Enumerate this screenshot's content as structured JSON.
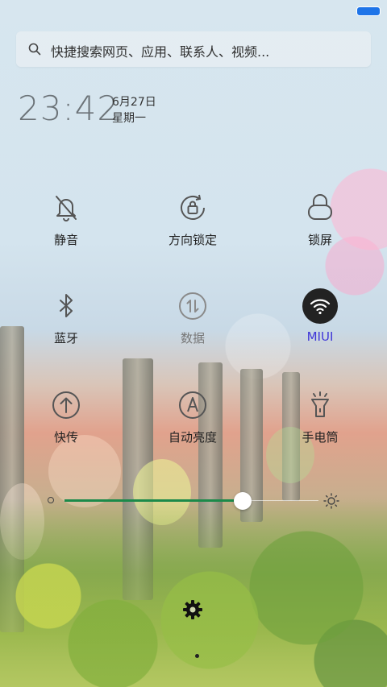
{
  "search": {
    "placeholder": "快捷搜索网页、应用、联系人、视频..."
  },
  "clock": {
    "time": "23:42",
    "date": "6月27日",
    "weekday": "星期一"
  },
  "toggles": [
    {
      "label": "静音",
      "icon": "bell-off-icon",
      "state": "off"
    },
    {
      "label": "方向锁定",
      "icon": "rotation-lock-icon",
      "state": "off"
    },
    {
      "label": "锁屏",
      "icon": "lock-icon",
      "state": "off"
    },
    {
      "label": "蓝牙",
      "icon": "bluetooth-icon",
      "state": "off"
    },
    {
      "label": "数据",
      "icon": "mobile-data-icon",
      "state": "disabled"
    },
    {
      "label": "MIUI",
      "icon": "wifi-icon",
      "state": "on"
    },
    {
      "label": "快传",
      "icon": "quick-transfer-icon",
      "state": "off"
    },
    {
      "label": "自动亮度",
      "icon": "auto-brightness-icon",
      "state": "off"
    },
    {
      "label": "手电筒",
      "icon": "flashlight-icon",
      "state": "off"
    }
  ],
  "brightness": {
    "level": 0.7
  },
  "colors": {
    "accent": "#3f36d8",
    "slider": "#1b8a4a",
    "battery": "#1e74e8"
  }
}
